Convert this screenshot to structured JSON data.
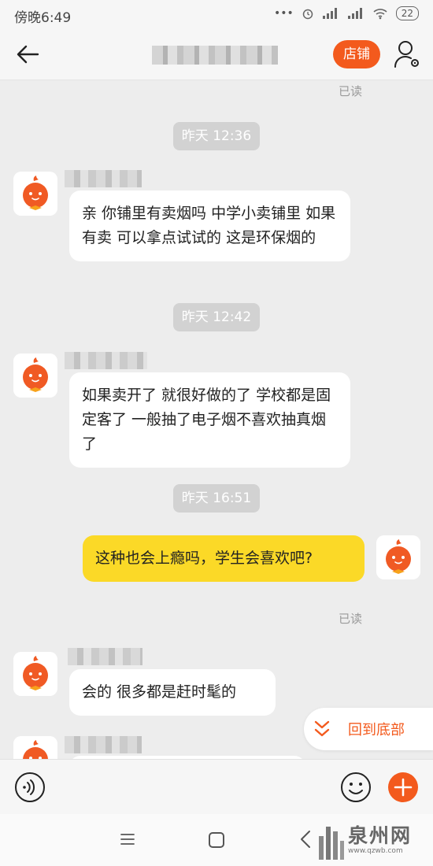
{
  "status_bar": {
    "time": "傍晚6:49",
    "battery": "22"
  },
  "header": {
    "shop_button": "店铺"
  },
  "chat": {
    "read_top": "已读",
    "messages": [
      {
        "timestamp": "昨天 12:36",
        "text": "亲 你铺里有卖烟吗 中学小卖铺里 如果有卖 可以拿点试试的 这是环保烟的"
      },
      {
        "timestamp": "昨天 12:42",
        "text": "如果卖开了 就很好做的了 学校都是固定客了 一般抽了电子烟不喜欢抽真烟了"
      },
      {
        "timestamp": "昨天 16:51",
        "text": "这种也会上瘾吗，学生会喜欢吧?",
        "read_label": "已读"
      },
      {
        "text": "会的 很多都是赶时髦的"
      }
    ]
  },
  "scroll_button": {
    "label": "回到底部"
  },
  "watermark": {
    "text": "泉州网",
    "url": "www.qzwb.com"
  },
  "colors": {
    "accent": "#f35a1d",
    "my_bubble": "#fbd927",
    "background": "#ededed"
  }
}
